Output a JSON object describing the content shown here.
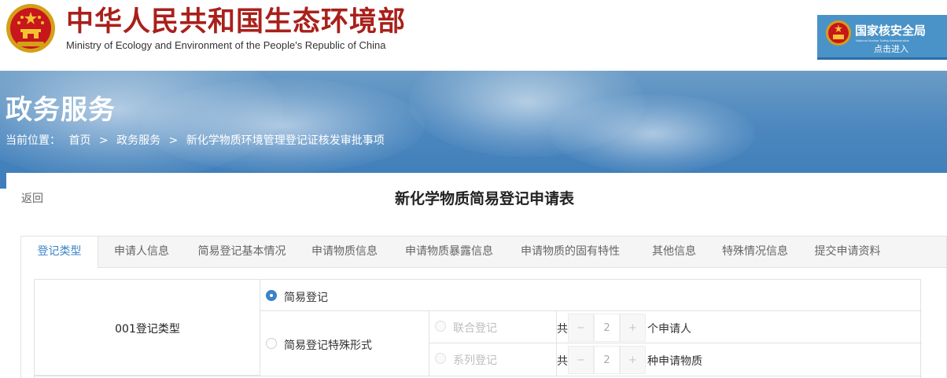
{
  "header": {
    "title": "中华人民共和国生态环境部",
    "subtitle": "Ministry of Ecology and Environment of the People's Republic of China",
    "nnsa": {
      "title": "国家核安全局",
      "english": "National Nuclear Safety Administration",
      "enter": "点击进入"
    }
  },
  "banner": {
    "title": "政务服务",
    "breadcrumb": {
      "prefix": "当前位置：",
      "items": [
        "首页",
        "政务服务",
        "新化学物质环境管理登记证核发审批事项"
      ],
      "separator": ">"
    }
  },
  "page": {
    "back": "返回",
    "form_title": "新化学物质简易登记申请表"
  },
  "tabs": [
    {
      "label": "登记类型",
      "active": true
    },
    {
      "label": "申请人信息"
    },
    {
      "label": "简易登记基本情况"
    },
    {
      "label": "申请物质信息"
    },
    {
      "label": "申请物质暴露信息"
    },
    {
      "label": "申请物质的固有特性"
    },
    {
      "label": "其他信息"
    },
    {
      "label": "特殊情况信息"
    },
    {
      "label": "提交申请资料"
    }
  ],
  "form": {
    "field_label": "001登记类型",
    "option_simple": "简易登记",
    "option_special": "简易登记特殊形式",
    "joint": {
      "label": "联合登记",
      "prefix": "共",
      "value": "2",
      "suffix": "个申请人"
    },
    "series": {
      "label": "系列登记",
      "prefix": "共",
      "value": "2",
      "suffix": "种申请物质"
    }
  },
  "colors": {
    "brand_red": "#a9201b",
    "accent_blue": "#3b82c9",
    "banner_blue": "#4d88bf"
  }
}
